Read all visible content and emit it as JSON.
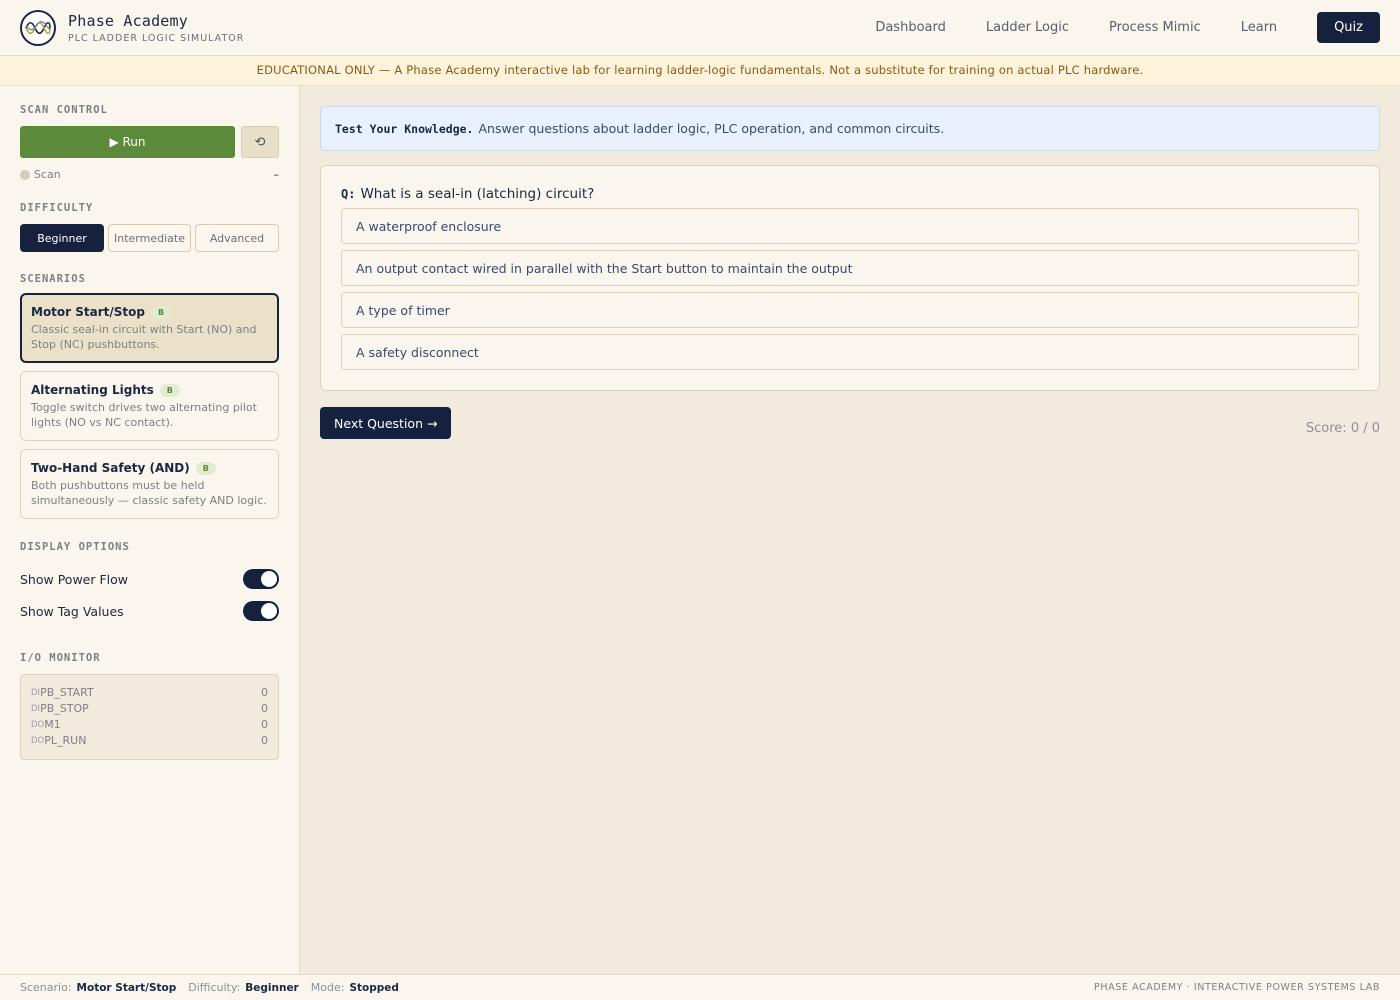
{
  "header": {
    "brand_name": "Phase Academy",
    "brand_sub": "PLC LADDER LOGIC SIMULATOR",
    "nav": [
      "Dashboard",
      "Ladder Logic",
      "Process Mimic",
      "Learn"
    ],
    "quiz_label": "Quiz"
  },
  "banner": "EDUCATIONAL ONLY — A Phase Academy interactive lab for learning ladder-logic fundamentals. Not a substitute for training on actual PLC hardware.",
  "sidebar": {
    "scan_control": {
      "title": "SCAN CONTROL",
      "run_label": "▶ Run",
      "reset_icon": "⟲",
      "scan_label": "Scan",
      "scan_value": "–"
    },
    "difficulty": {
      "title": "DIFFICULTY",
      "options": [
        "Beginner",
        "Intermediate",
        "Advanced"
      ],
      "selected": "Beginner"
    },
    "scenarios": {
      "title": "SCENARIOS",
      "items": [
        {
          "title": "Motor Start/Stop",
          "badge": "B",
          "desc": "Classic seal-in circuit with Start (NO) and Stop (NC) pushbuttons."
        },
        {
          "title": "Alternating Lights",
          "badge": "B",
          "desc": "Toggle switch drives two alternating pilot lights (NO vs NC contact)."
        },
        {
          "title": "Two-Hand Safety (AND)",
          "badge": "B",
          "desc": "Both pushbuttons must be held simultaneously — classic safety AND logic."
        }
      ]
    },
    "display_options": {
      "title": "DISPLAY OPTIONS",
      "items": [
        {
          "label": "Show Power Flow",
          "on": true
        },
        {
          "label": "Show Tag Values",
          "on": true
        }
      ]
    },
    "io_monitor": {
      "title": "I/O MONITOR",
      "rows": [
        {
          "type": "DI",
          "tag": "PB_START",
          "value": "0"
        },
        {
          "type": "DI",
          "tag": "PB_STOP",
          "value": "0"
        },
        {
          "type": "DO",
          "tag": "M1",
          "value": "0"
        },
        {
          "type": "DO",
          "tag": "PL_RUN",
          "value": "0"
        }
      ]
    }
  },
  "main": {
    "info_strong": "Test Your Knowledge.",
    "info_text": "Answer questions about ladder logic, PLC operation, and common circuits.",
    "q_label": "Q:",
    "question": "What is a seal-in (latching) circuit?",
    "answers": [
      "A waterproof enclosure",
      "An output contact wired in parallel with the Start button to maintain the output",
      "A type of timer",
      "A safety disconnect"
    ],
    "next_label": "Next Question →",
    "score": "Score: 0 / 0"
  },
  "statusbar": {
    "scenario_label": "Scenario:",
    "scenario_value": "Motor Start/Stop",
    "difficulty_label": "Difficulty:",
    "difficulty_value": "Beginner",
    "mode_label": "Mode:",
    "mode_value": "Stopped",
    "right": "PHASE ACADEMY · INTERACTIVE POWER SYSTEMS LAB"
  },
  "colors": {
    "navy": "#16213e",
    "run_green": "#5d8a3a",
    "banner_bg": "#fdf3dc",
    "info_bg": "#e8f0fb"
  }
}
